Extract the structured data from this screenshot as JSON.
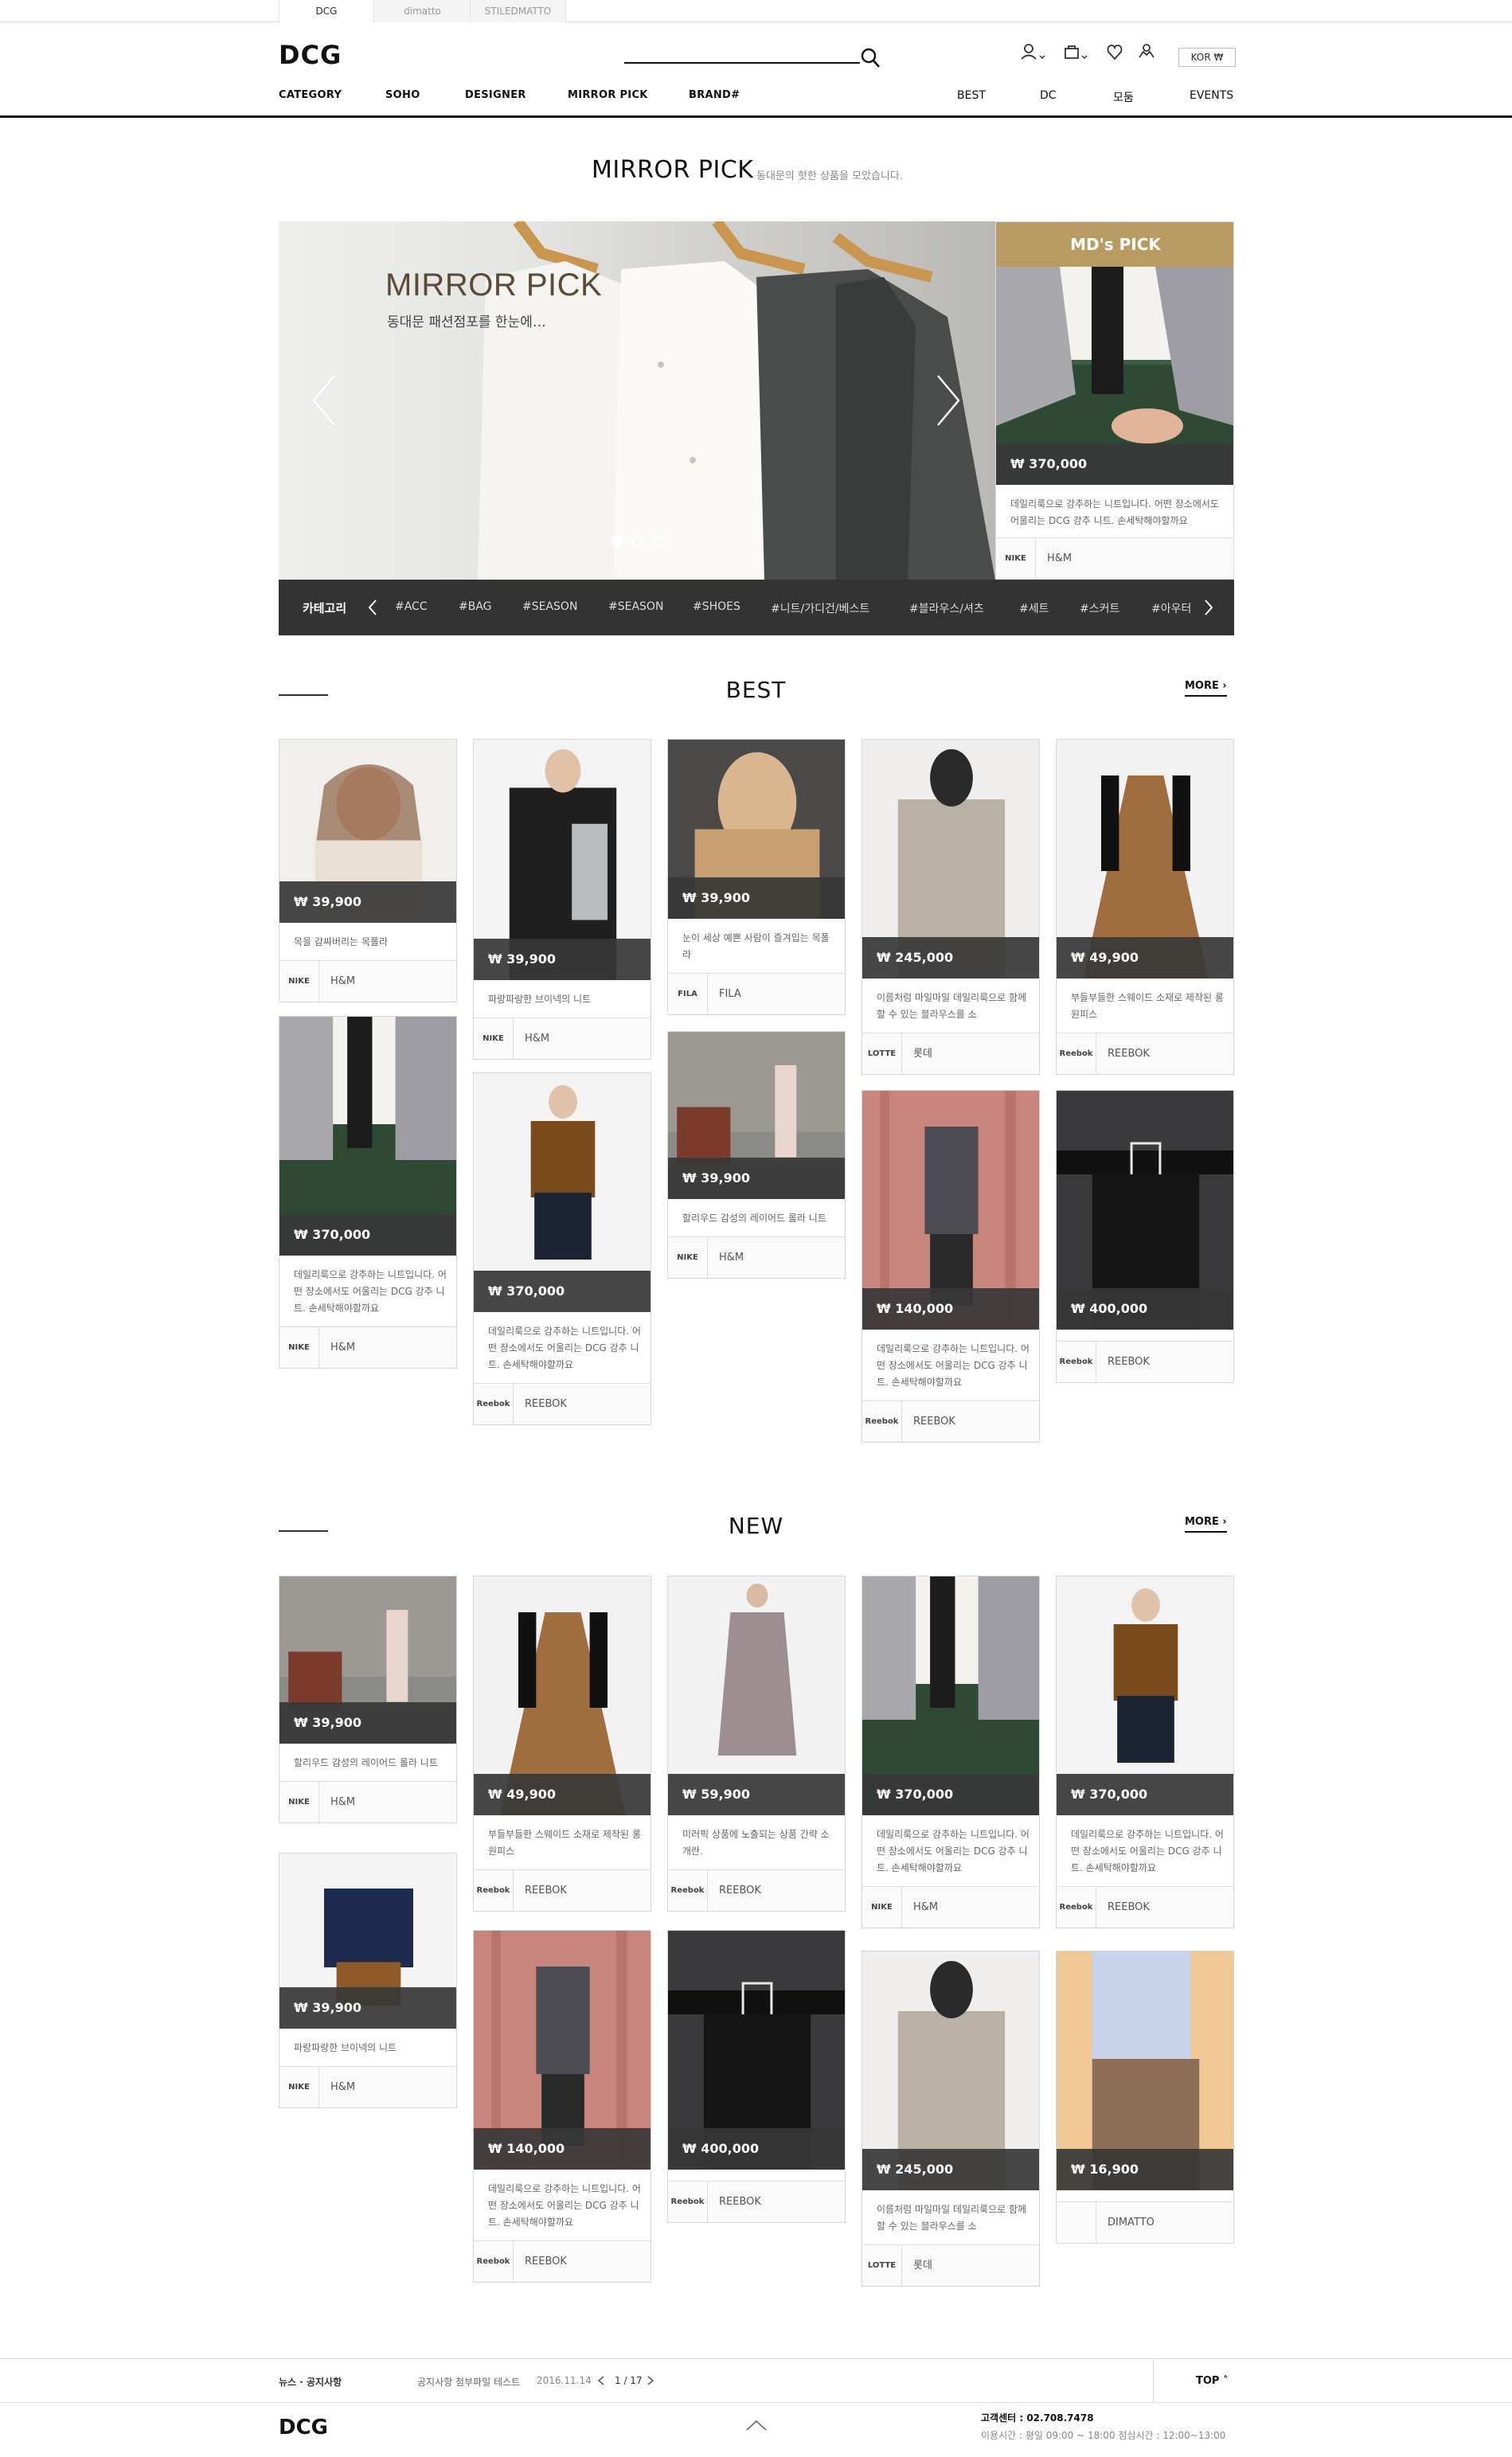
{
  "site_tabs": [
    "DCG",
    "dimatto",
    "STILEDMATTO"
  ],
  "header": {
    "logo": "DCG",
    "lang": "KOR ₩",
    "nav_left": [
      "CATEGORY",
      "SOHO",
      "DESIGNER",
      "MIRROR PICK",
      "BRAND#"
    ],
    "nav_right": [
      "BEST",
      "DC",
      "모둠",
      "EVENTS"
    ]
  },
  "page": {
    "title": "MIRROR PICK",
    "subtitle": "동대문의 핫한 상품을 모았습니다."
  },
  "hero": {
    "title": "MIRROR PICK",
    "subtitle": "동대문 패션점포를 한눈에…"
  },
  "categories": {
    "label": "카테고리",
    "items": [
      "#ACC",
      "#BAG",
      "#SEASON",
      "#SEASON",
      "#SHOES",
      "#니트/가디건/베스트",
      "#블라우스/셔츠",
      "#세트",
      "#스커트",
      "#아우터"
    ]
  },
  "mdpick": {
    "label": "MD's PICK",
    "price": "₩ 370,000",
    "desc": "데일리룩으로 강추하는 니트입니다. 어떤 장소에서도 어울리는 DCG 강추 니트. 손세탁해야할까요",
    "brand": "H&M",
    "brand_logo": "NIKE"
  },
  "best": {
    "title": "BEST",
    "more": "MORE",
    "items": [
      {
        "price": "₩ 39,900",
        "desc": "목을 감싸버리는 목폴라",
        "brand": "H&M",
        "logo": "NIKE",
        "img": "portrait"
      },
      {
        "price": "₩ 39,900",
        "desc": "파랑파랑한 브이넥의 니트",
        "brand": "H&M",
        "logo": "NIKE",
        "img": "jacket"
      },
      {
        "price": "₩ 39,900",
        "desc": "눈이 세상 예쁜 사람이 즐겨입는 목폴라",
        "brand": "FILA",
        "logo": "FILA",
        "img": "knit"
      },
      {
        "price": "₩ 245,000",
        "desc": "이름처럼 마일마일 데일리룩으로 함께할 수 있는 블라우스를 소",
        "brand": "롯데",
        "logo": "LOTTE",
        "img": "coat"
      },
      {
        "price": "₩ 49,900",
        "desc": "부들부들한 스웨이드 소재로 제작된 롱원피스",
        "brand": "REEBOK",
        "logo": "Reebok",
        "img": "dress"
      },
      {
        "price": "₩ 370,000",
        "desc": "데일리룩으로 강추하는 니트입니다. 어떤 장소에서도 어울리는 DCG 강추 니트. 손세탁해야할까요",
        "brand": "H&M",
        "logo": "NIKE",
        "img": "skirt"
      },
      {
        "price": "₩ 370,000",
        "desc": "데일리룩으로 강추하는 니트입니다. 어떤 장소에서도 어울리는 DCG 강추 니트. 손세탁해야할까요",
        "brand": "REEBOK",
        "logo": "Reebok",
        "img": "model"
      },
      {
        "price": "₩ 39,900",
        "desc": "할리우드 감성의 레이어드 롤라 니트",
        "brand": "H&M",
        "logo": "NIKE",
        "img": "street"
      },
      {
        "price": "₩ 140,000",
        "desc": "데일리룩으로 강추하는 니트입니다. 어떤 장소에서도 어울리는 DCG 강추 니트. 손세탁해야할까요",
        "brand": "REEBOK",
        "logo": "Reebok",
        "img": "curtain"
      },
      {
        "price": "₩ 400,000",
        "desc": "",
        "brand": "REEBOK",
        "logo": "Reebok",
        "img": "belt"
      }
    ]
  },
  "new": {
    "title": "NEW",
    "more": "MORE",
    "items": [
      {
        "price": "₩ 39,900",
        "desc": "할리우드 감성의 레이어드 롤라 니트",
        "brand": "H&M",
        "logo": "NIKE",
        "img": "street"
      },
      {
        "price": "₩ 49,900",
        "desc": "부들부들한 스웨이드 소재로 제작된 롱원피스",
        "brand": "REEBOK",
        "logo": "Reebok",
        "img": "dress"
      },
      {
        "price": "₩ 59,900",
        "desc": "미러픽 상품에 노출되는 상품 간략 소개란.",
        "brand": "REEBOK",
        "logo": "Reebok",
        "img": "longknit"
      },
      {
        "price": "₩ 370,000",
        "desc": "데일리룩으로 강추하는 니트입니다. 어떤 장소에서도 어울리는 DCG 강추 니트. 손세탁해야할까요",
        "brand": "H&M",
        "logo": "NIKE",
        "img": "skirt"
      },
      {
        "price": "₩ 370,000",
        "desc": "데일리룩으로 강추하는 니트입니다. 어떤 장소에서도 어울리는 DCG 강추 니트. 손세탁해야할까요",
        "brand": "REEBOK",
        "logo": "Reebok",
        "img": "model"
      },
      {
        "price": "₩ 39,900",
        "desc": "파랑파랑한 브이넥의 니트",
        "brand": "H&M",
        "logo": "NIKE",
        "img": "navy"
      },
      {
        "price": "₩ 140,000",
        "desc": "데일리룩으로 강추하는 니트입니다. 어떤 장소에서도 어울리는 DCG 강추 니트. 손세탁해야할까요",
        "brand": "REEBOK",
        "logo": "Reebok",
        "img": "curtain"
      },
      {
        "price": "₩ 400,000",
        "desc": "",
        "brand": "REEBOK",
        "logo": "Reebok",
        "img": "belt"
      },
      {
        "price": "₩ 245,000",
        "desc": "이름처럼 마일마일 데일리룩으로 함께할 수 있는 블라우스를 소",
        "brand": "롯데",
        "logo": "LOTTE",
        "img": "coat"
      },
      {
        "price": "₩ 16,900",
        "desc": "",
        "brand": "DIMATTO",
        "logo": "",
        "img": "snake"
      }
    ]
  },
  "notice": {
    "label": "뉴스 · 공지사항",
    "text": "공지사항 첨부파일 테스트",
    "date": "2016.11.14",
    "page": "1 / 17",
    "top": "TOP"
  },
  "footer": {
    "logo": "DCG",
    "cs_label": "고객센터 : 02.708.7478",
    "hours": "이용시간 : 평일 09:00 ~ 18:00 점심시간 : 12:00~13:00"
  }
}
